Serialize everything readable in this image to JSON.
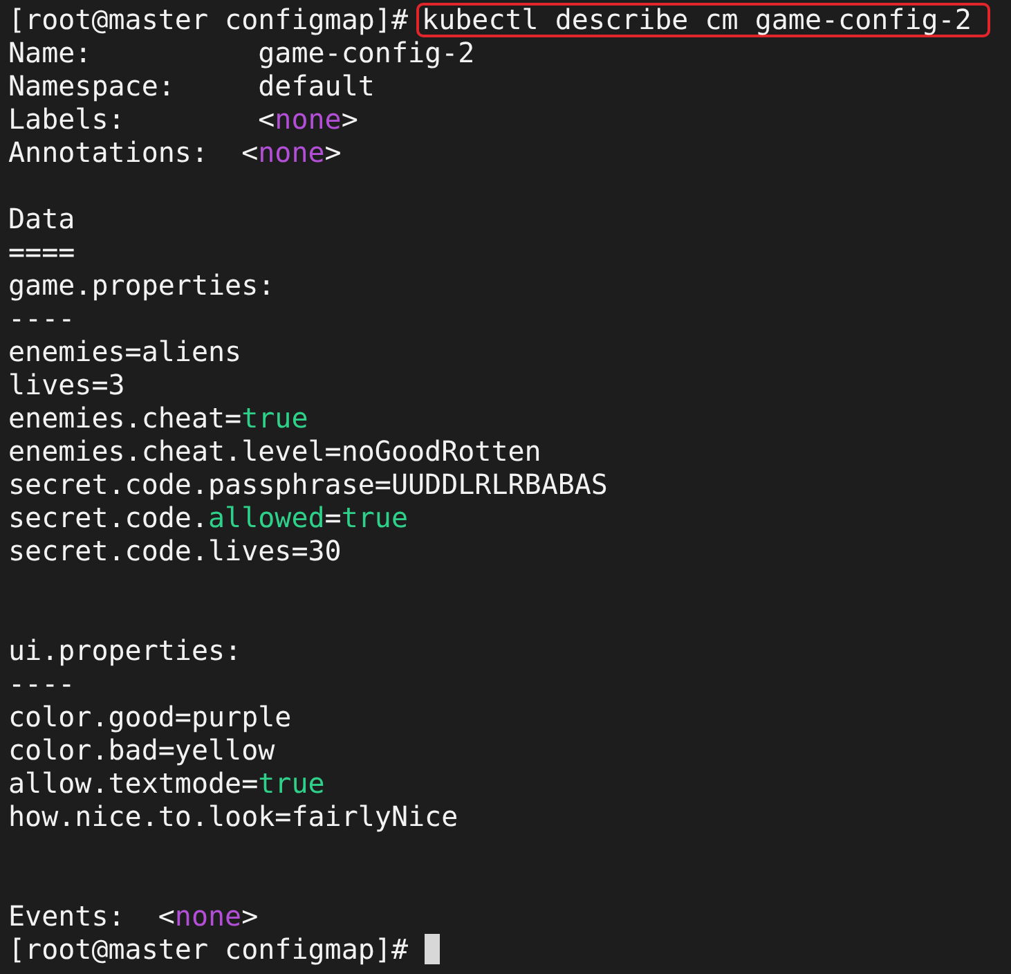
{
  "terminal": {
    "lines": [
      {
        "kind": "text",
        "segments": [
          {
            "text": "[root@master configmap]# "
          },
          {
            "text": "kubectl describe cm game-config-2",
            "highlighted": true
          }
        ]
      },
      {
        "kind": "text",
        "segments": [
          {
            "text": "Name:          game-config-2"
          }
        ]
      },
      {
        "kind": "text",
        "segments": [
          {
            "text": "Namespace:     default"
          }
        ]
      },
      {
        "kind": "text",
        "segments": [
          {
            "text": "Labels:        <"
          },
          {
            "text": "none",
            "color": "#b34fd6"
          },
          {
            "text": ">"
          }
        ]
      },
      {
        "kind": "text",
        "segments": [
          {
            "text": "Annotations:  <"
          },
          {
            "text": "none",
            "color": "#b34fd6"
          },
          {
            "text": ">"
          }
        ]
      },
      {
        "kind": "blank"
      },
      {
        "kind": "text",
        "segments": [
          {
            "text": "Data"
          }
        ]
      },
      {
        "kind": "text",
        "segments": [
          {
            "text": "===="
          }
        ]
      },
      {
        "kind": "text",
        "segments": [
          {
            "text": "game.properties:"
          }
        ]
      },
      {
        "kind": "text",
        "segments": [
          {
            "text": "----"
          }
        ]
      },
      {
        "kind": "text",
        "segments": [
          {
            "text": "enemies=aliens"
          }
        ]
      },
      {
        "kind": "text",
        "segments": [
          {
            "text": "lives=3"
          }
        ]
      },
      {
        "kind": "text",
        "segments": [
          {
            "text": "enemies.cheat="
          },
          {
            "text": "true",
            "color": "#2fd08a"
          }
        ]
      },
      {
        "kind": "text",
        "segments": [
          {
            "text": "enemies.cheat.level=noGoodRotten"
          }
        ]
      },
      {
        "kind": "text",
        "segments": [
          {
            "text": "secret.code.passphrase=UUDDLRLRBABAS"
          }
        ]
      },
      {
        "kind": "text",
        "segments": [
          {
            "text": "secret.code."
          },
          {
            "text": "allowed",
            "color": "#2fd08a"
          },
          {
            "text": "="
          },
          {
            "text": "true",
            "color": "#2fd08a"
          }
        ]
      },
      {
        "kind": "text",
        "segments": [
          {
            "text": "secret.code.lives=30"
          }
        ]
      },
      {
        "kind": "blank"
      },
      {
        "kind": "blank"
      },
      {
        "kind": "text",
        "segments": [
          {
            "text": "ui.properties:"
          }
        ]
      },
      {
        "kind": "text",
        "segments": [
          {
            "text": "----"
          }
        ]
      },
      {
        "kind": "text",
        "segments": [
          {
            "text": "color.good=purple"
          }
        ]
      },
      {
        "kind": "text",
        "segments": [
          {
            "text": "color.bad=yellow"
          }
        ]
      },
      {
        "kind": "text",
        "segments": [
          {
            "text": "allow.textmode="
          },
          {
            "text": "true",
            "color": "#2fd08a"
          }
        ]
      },
      {
        "kind": "text",
        "segments": [
          {
            "text": "how.nice.to.look=fairlyNice"
          }
        ]
      },
      {
        "kind": "blank"
      },
      {
        "kind": "blank"
      },
      {
        "kind": "text",
        "segments": [
          {
            "text": "Events:  <"
          },
          {
            "text": "none",
            "color": "#b34fd6"
          },
          {
            "text": ">"
          }
        ]
      },
      {
        "kind": "text",
        "segments": [
          {
            "text": "[root@master configmap]# "
          }
        ],
        "cursor": true
      }
    ]
  }
}
